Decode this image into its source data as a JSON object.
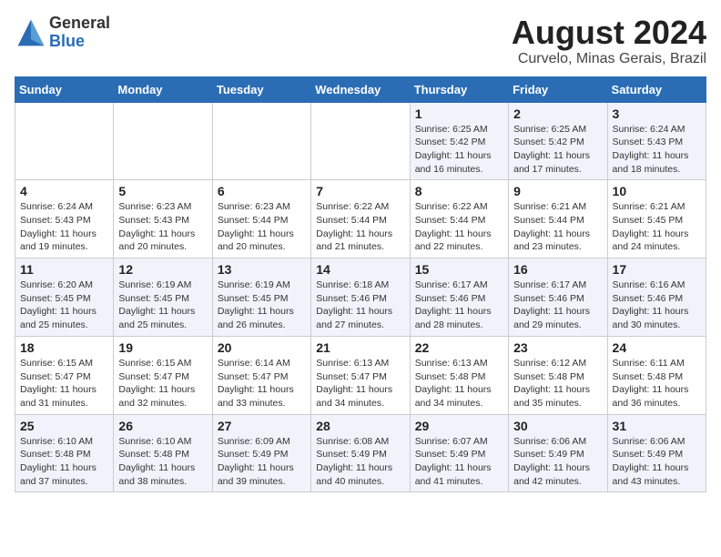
{
  "logo": {
    "general": "General",
    "blue": "Blue"
  },
  "title": {
    "month_year": "August 2024",
    "location": "Curvelo, Minas Gerais, Brazil"
  },
  "weekdays": [
    "Sunday",
    "Monday",
    "Tuesday",
    "Wednesday",
    "Thursday",
    "Friday",
    "Saturday"
  ],
  "weeks": [
    [
      {
        "day": "",
        "info": ""
      },
      {
        "day": "",
        "info": ""
      },
      {
        "day": "",
        "info": ""
      },
      {
        "day": "",
        "info": ""
      },
      {
        "day": "1",
        "info": "Sunrise: 6:25 AM\nSunset: 5:42 PM\nDaylight: 11 hours\nand 16 minutes."
      },
      {
        "day": "2",
        "info": "Sunrise: 6:25 AM\nSunset: 5:42 PM\nDaylight: 11 hours\nand 17 minutes."
      },
      {
        "day": "3",
        "info": "Sunrise: 6:24 AM\nSunset: 5:43 PM\nDaylight: 11 hours\nand 18 minutes."
      }
    ],
    [
      {
        "day": "4",
        "info": "Sunrise: 6:24 AM\nSunset: 5:43 PM\nDaylight: 11 hours\nand 19 minutes."
      },
      {
        "day": "5",
        "info": "Sunrise: 6:23 AM\nSunset: 5:43 PM\nDaylight: 11 hours\nand 20 minutes."
      },
      {
        "day": "6",
        "info": "Sunrise: 6:23 AM\nSunset: 5:44 PM\nDaylight: 11 hours\nand 20 minutes."
      },
      {
        "day": "7",
        "info": "Sunrise: 6:22 AM\nSunset: 5:44 PM\nDaylight: 11 hours\nand 21 minutes."
      },
      {
        "day": "8",
        "info": "Sunrise: 6:22 AM\nSunset: 5:44 PM\nDaylight: 11 hours\nand 22 minutes."
      },
      {
        "day": "9",
        "info": "Sunrise: 6:21 AM\nSunset: 5:44 PM\nDaylight: 11 hours\nand 23 minutes."
      },
      {
        "day": "10",
        "info": "Sunrise: 6:21 AM\nSunset: 5:45 PM\nDaylight: 11 hours\nand 24 minutes."
      }
    ],
    [
      {
        "day": "11",
        "info": "Sunrise: 6:20 AM\nSunset: 5:45 PM\nDaylight: 11 hours\nand 25 minutes."
      },
      {
        "day": "12",
        "info": "Sunrise: 6:19 AM\nSunset: 5:45 PM\nDaylight: 11 hours\nand 25 minutes."
      },
      {
        "day": "13",
        "info": "Sunrise: 6:19 AM\nSunset: 5:45 PM\nDaylight: 11 hours\nand 26 minutes."
      },
      {
        "day": "14",
        "info": "Sunrise: 6:18 AM\nSunset: 5:46 PM\nDaylight: 11 hours\nand 27 minutes."
      },
      {
        "day": "15",
        "info": "Sunrise: 6:17 AM\nSunset: 5:46 PM\nDaylight: 11 hours\nand 28 minutes."
      },
      {
        "day": "16",
        "info": "Sunrise: 6:17 AM\nSunset: 5:46 PM\nDaylight: 11 hours\nand 29 minutes."
      },
      {
        "day": "17",
        "info": "Sunrise: 6:16 AM\nSunset: 5:46 PM\nDaylight: 11 hours\nand 30 minutes."
      }
    ],
    [
      {
        "day": "18",
        "info": "Sunrise: 6:15 AM\nSunset: 5:47 PM\nDaylight: 11 hours\nand 31 minutes."
      },
      {
        "day": "19",
        "info": "Sunrise: 6:15 AM\nSunset: 5:47 PM\nDaylight: 11 hours\nand 32 minutes."
      },
      {
        "day": "20",
        "info": "Sunrise: 6:14 AM\nSunset: 5:47 PM\nDaylight: 11 hours\nand 33 minutes."
      },
      {
        "day": "21",
        "info": "Sunrise: 6:13 AM\nSunset: 5:47 PM\nDaylight: 11 hours\nand 34 minutes."
      },
      {
        "day": "22",
        "info": "Sunrise: 6:13 AM\nSunset: 5:48 PM\nDaylight: 11 hours\nand 34 minutes."
      },
      {
        "day": "23",
        "info": "Sunrise: 6:12 AM\nSunset: 5:48 PM\nDaylight: 11 hours\nand 35 minutes."
      },
      {
        "day": "24",
        "info": "Sunrise: 6:11 AM\nSunset: 5:48 PM\nDaylight: 11 hours\nand 36 minutes."
      }
    ],
    [
      {
        "day": "25",
        "info": "Sunrise: 6:10 AM\nSunset: 5:48 PM\nDaylight: 11 hours\nand 37 minutes."
      },
      {
        "day": "26",
        "info": "Sunrise: 6:10 AM\nSunset: 5:48 PM\nDaylight: 11 hours\nand 38 minutes."
      },
      {
        "day": "27",
        "info": "Sunrise: 6:09 AM\nSunset: 5:49 PM\nDaylight: 11 hours\nand 39 minutes."
      },
      {
        "day": "28",
        "info": "Sunrise: 6:08 AM\nSunset: 5:49 PM\nDaylight: 11 hours\nand 40 minutes."
      },
      {
        "day": "29",
        "info": "Sunrise: 6:07 AM\nSunset: 5:49 PM\nDaylight: 11 hours\nand 41 minutes."
      },
      {
        "day": "30",
        "info": "Sunrise: 6:06 AM\nSunset: 5:49 PM\nDaylight: 11 hours\nand 42 minutes."
      },
      {
        "day": "31",
        "info": "Sunrise: 6:06 AM\nSunset: 5:49 PM\nDaylight: 11 hours\nand 43 minutes."
      }
    ]
  ]
}
